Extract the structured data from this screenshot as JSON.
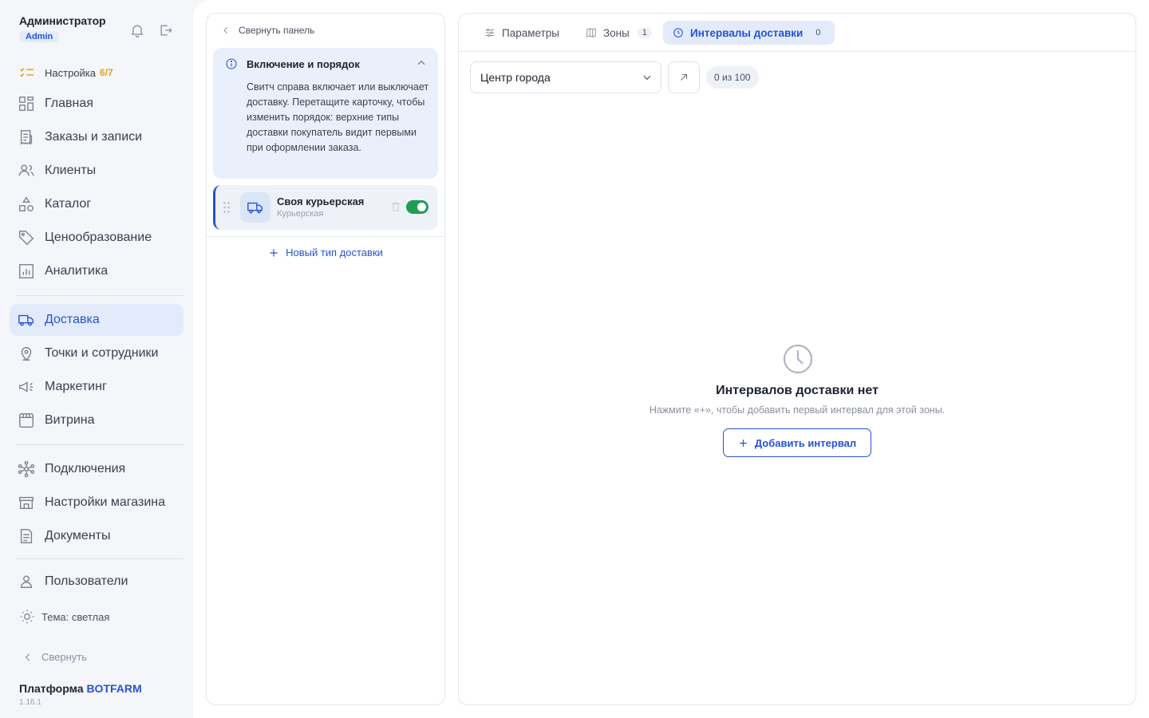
{
  "sidebar": {
    "user_name": "Администратор",
    "user_role": "Admin",
    "setup_label": "Настройка",
    "setup_count": "6/7",
    "items": [
      {
        "label": "Главная",
        "icon": "grid-icon"
      },
      {
        "label": "Заказы и записи",
        "icon": "receipt-icon"
      },
      {
        "label": "Клиенты",
        "icon": "users-icon"
      },
      {
        "label": "Каталог",
        "icon": "shapes-icon"
      },
      {
        "label": "Ценообразование",
        "icon": "tag-icon"
      },
      {
        "label": "Аналитика",
        "icon": "chart-icon"
      },
      {
        "label": "Доставка",
        "icon": "truck-icon",
        "active": true
      },
      {
        "label": "Точки и сотрудники",
        "icon": "map-pin-icon"
      },
      {
        "label": "Маркетинг",
        "icon": "megaphone-icon"
      },
      {
        "label": "Витрина",
        "icon": "storefront-icon"
      },
      {
        "label": "Подключения",
        "icon": "network-icon"
      },
      {
        "label": "Настройки магазина",
        "icon": "store-settings-icon"
      },
      {
        "label": "Документы",
        "icon": "document-icon"
      },
      {
        "label": "Пользователи",
        "icon": "user-icon"
      }
    ],
    "theme_label": "Тема: светлая",
    "collapse_label": "Свернуть",
    "platform_prefix": "Платформа",
    "platform_brand": "BOTFARM",
    "version": "1.16.1"
  },
  "middle": {
    "collapse_label": "Свернуть панель",
    "info_title": "Включение и порядок",
    "info_text": "Свитч справа включает или выключает доставку. Перетащите карточку, чтобы изменить порядок: верхние типы доставки покупатель видит первыми при оформлении заказа.",
    "delivery": {
      "name": "Своя курьерская",
      "subtitle": "Курьерская",
      "enabled": true
    },
    "new_type_label": "Новый тип доставки"
  },
  "right": {
    "tabs": [
      {
        "label": "Параметры",
        "badge": ""
      },
      {
        "label": "Зоны",
        "badge": "1"
      },
      {
        "label": "Интервалы доставки",
        "badge": "0",
        "active": true
      }
    ],
    "zone_value": "Центр города",
    "count_label": "0 из 100",
    "empty_title": "Интервалов доставки нет",
    "empty_subtitle": "Нажмите «+», чтобы добавить первый интервал для этой зоны.",
    "add_button": "Добавить интервал"
  },
  "colors": {
    "accent": "#2452d6",
    "toggle_on": "#1f9d55",
    "setup_highlight": "#e7a21b"
  }
}
